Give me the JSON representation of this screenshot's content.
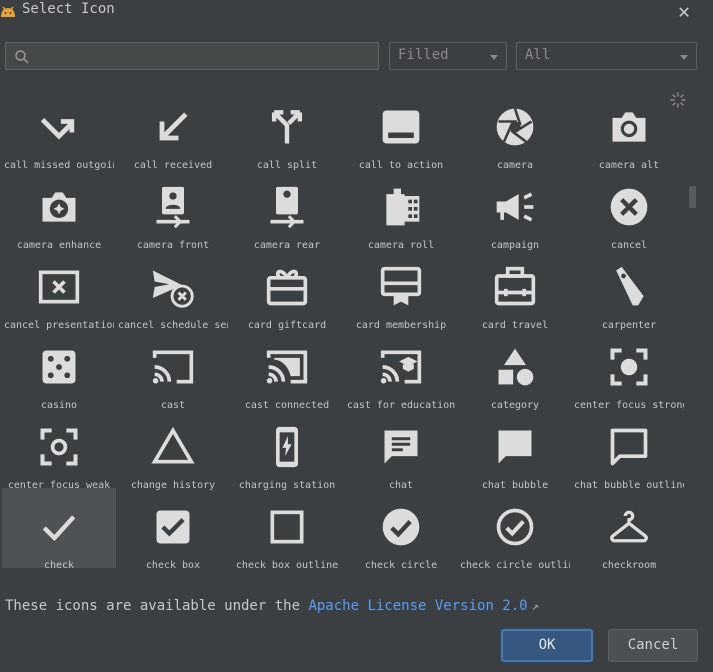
{
  "dialog": {
    "title": "Select Icon",
    "close_icon": "close-icon",
    "app_icon": "android-icon"
  },
  "search": {
    "value": "",
    "placeholder": "",
    "icon": "search-icon"
  },
  "filters": {
    "style_value": "Filled",
    "category_value": "All"
  },
  "icons": [
    {
      "label": "call missed outgoing",
      "icon": "call-missed-outgoing-icon"
    },
    {
      "label": "call received",
      "icon": "call-received-icon"
    },
    {
      "label": "call split",
      "icon": "call-split-icon"
    },
    {
      "label": "call to action",
      "icon": "call-to-action-icon"
    },
    {
      "label": "camera",
      "icon": "camera-icon"
    },
    {
      "label": "camera alt",
      "icon": "camera-alt-icon"
    },
    {
      "label": "camera enhance",
      "icon": "camera-enhance-icon"
    },
    {
      "label": "camera front",
      "icon": "camera-front-icon"
    },
    {
      "label": "camera rear",
      "icon": "camera-rear-icon"
    },
    {
      "label": "camera roll",
      "icon": "camera-roll-icon"
    },
    {
      "label": "campaign",
      "icon": "campaign-icon"
    },
    {
      "label": "cancel",
      "icon": "cancel-icon"
    },
    {
      "label": "cancel presentation",
      "icon": "cancel-presentation-icon"
    },
    {
      "label": "cancel schedule send",
      "icon": "cancel-schedule-send-icon"
    },
    {
      "label": "card giftcard",
      "icon": "card-giftcard-icon"
    },
    {
      "label": "card membership",
      "icon": "card-membership-icon"
    },
    {
      "label": "card travel",
      "icon": "card-travel-icon"
    },
    {
      "label": "carpenter",
      "icon": "carpenter-icon"
    },
    {
      "label": "casino",
      "icon": "casino-icon"
    },
    {
      "label": "cast",
      "icon": "cast-icon"
    },
    {
      "label": "cast connected",
      "icon": "cast-connected-icon"
    },
    {
      "label": "cast for education",
      "icon": "cast-for-education-icon"
    },
    {
      "label": "category",
      "icon": "category-icon"
    },
    {
      "label": "center focus strong",
      "icon": "center-focus-strong-icon"
    },
    {
      "label": "center focus weak",
      "icon": "center-focus-weak-icon"
    },
    {
      "label": "change history",
      "icon": "change-history-icon"
    },
    {
      "label": "charging station",
      "icon": "charging-station-icon"
    },
    {
      "label": "chat",
      "icon": "chat-icon"
    },
    {
      "label": "chat bubble",
      "icon": "chat-bubble-icon"
    },
    {
      "label": "chat bubble outline",
      "icon": "chat-bubble-outline-icon"
    },
    {
      "label": "check",
      "icon": "check-icon",
      "selected": true
    },
    {
      "label": "check box",
      "icon": "check-box-icon"
    },
    {
      "label": "check box outline",
      "icon": "check-box-outline-icon"
    },
    {
      "label": "check circle",
      "icon": "check-circle-icon"
    },
    {
      "label": "check circle outline",
      "icon": "check-circle-outline-icon"
    },
    {
      "label": "checkroom",
      "icon": "checkroom-icon"
    }
  ],
  "footer": {
    "license_prefix": "These icons are available under the ",
    "license_link": "Apache License Version 2.0",
    "ok_label": "OK",
    "cancel_label": "Cancel"
  },
  "colors": {
    "background": "#3c3f41",
    "icon": "#dcdcdc",
    "link": "#589df6",
    "ok_button": "#365880",
    "selected_cell": "#4e5254"
  }
}
